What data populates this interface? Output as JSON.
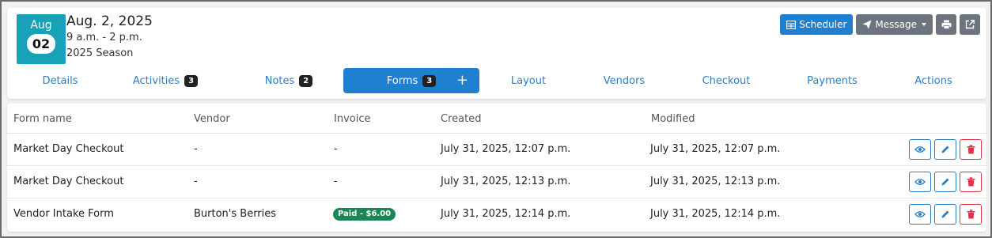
{
  "event": {
    "month": "Aug",
    "day": "02",
    "date": "Aug. 2, 2025",
    "time": "9 a.m. - 2 p.m.",
    "season": "2025 Season"
  },
  "toolbar": {
    "scheduler_label": "Scheduler",
    "message_label": "Message",
    "print_icon": "printer-icon",
    "open_icon": "external-link-icon"
  },
  "tabs": [
    {
      "label": "Details",
      "count": ""
    },
    {
      "label": "Activities",
      "count": "3"
    },
    {
      "label": "Notes",
      "count": "2"
    },
    {
      "label": "Forms",
      "count": "3",
      "active": true
    },
    {
      "label": "Layout",
      "count": ""
    },
    {
      "label": "Vendors",
      "count": ""
    },
    {
      "label": "Checkout",
      "count": ""
    },
    {
      "label": "Payments",
      "count": ""
    },
    {
      "label": "Actions",
      "count": ""
    }
  ],
  "forms_table": {
    "headers": [
      "Form name",
      "Vendor",
      "Invoice",
      "Created",
      "Modified"
    ],
    "rows": [
      {
        "form_name": "Market Day Checkout",
        "vendor": "-",
        "invoice": "-",
        "created": "July 31, 2025, 12:07 p.m.",
        "modified": "July 31, 2025, 12:07 p.m."
      },
      {
        "form_name": "Market Day Checkout",
        "vendor": "-",
        "invoice": "-",
        "created": "July 31, 2025, 12:13 p.m.",
        "modified": "July 31, 2025, 12:13 p.m."
      },
      {
        "form_name": "Vendor Intake Form",
        "vendor": "Burton's Berries",
        "invoice": "Paid - $6.00",
        "created": "July 31, 2025, 12:14 p.m.",
        "modified": "July 31, 2025, 12:14 p.m."
      }
    ]
  },
  "colors": {
    "accent": "#1f7fd1",
    "date_badge": "#17a2b8",
    "paid": "#198754",
    "danger": "#dc3545",
    "secondary": "#6c757d"
  }
}
